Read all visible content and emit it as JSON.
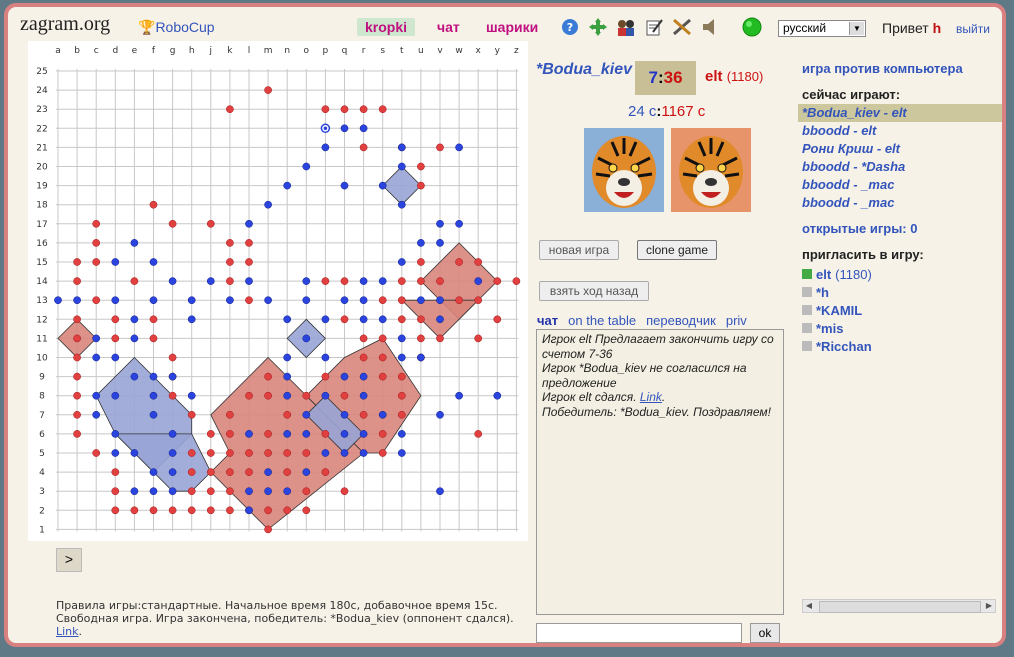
{
  "header": {
    "site": "zagram.org",
    "robocup": "RoboCup",
    "nav": [
      "kropki",
      "чат",
      "шарики"
    ],
    "icons": [
      "help-icon",
      "move-icon",
      "users-icon",
      "edit-icon",
      "tools-icon",
      "sound-icon",
      "status-icon"
    ],
    "language": "русский",
    "hello_prefix": "Привет ",
    "hello_user": "h",
    "logout": "выйти"
  },
  "board": {
    "columns": [
      "a",
      "b",
      "c",
      "d",
      "e",
      "f",
      "g",
      "h",
      "j",
      "k",
      "l",
      "m",
      "n",
      "o",
      "p",
      "q",
      "r",
      "s",
      "t",
      "u",
      "v",
      "w",
      "x",
      "y",
      "z"
    ],
    "rows": [
      "25",
      "24",
      "23",
      "22",
      "21",
      "20",
      "19",
      "18",
      "17",
      "16",
      "15",
      "14",
      "13",
      "12",
      "11",
      "10",
      "9",
      "8",
      "7",
      "6",
      "5",
      "4",
      "3",
      "2",
      "1"
    ],
    "colors": {
      "red": "#e04040",
      "blue": "#2a44dd",
      "red_area": "#d8857c",
      "blue_area": "#99a4d6"
    }
  },
  "game": {
    "player1": "*Bodua_kiev",
    "score1": "7",
    "score2": "36",
    "player2": "elt",
    "player2_rating": "(1180)",
    "time1": "24 с",
    "time2": "1167 с",
    "new_game": "новая игра",
    "clone_game": "clone game",
    "undo": "взять ход назад",
    "next": ">"
  },
  "chat": {
    "tabs": [
      "чат",
      "on the table",
      "переводчик",
      "priv"
    ],
    "lines": [
      "Игрок elt Предлагает закончить игру со счетом 7-36",
      "Игрок *Bodua_kiev не согласился на предложение",
      "Игрок elt сдался. ",
      "Победитель: *Bodua_kiev. Поздравляем!"
    ],
    "link": "Link",
    "ok": "ok"
  },
  "rules": {
    "text": "Правила игры:стандартные. Начальное время 180с, добавочное время 15с. Свободная игра. Игра закончена, победитель: *Bodua_kiev (оппонент сдался). ",
    "link": "Link"
  },
  "sidebar": {
    "vs_computer": "игра против компьютера",
    "now_playing": "сейчас играют:",
    "games": [
      "*Bodua_kiev - elt",
      "bboodd - elt",
      "Рони Криш - elt",
      "bboodd - *Dasha",
      "bboodd - _mac",
      "bboodd - _mac"
    ],
    "open_games": "открытые игры: 0",
    "invite": "пригласить в игру:",
    "users": [
      {
        "name": "elt",
        "rating": "(1180)",
        "online": true
      },
      {
        "name": "*h",
        "rating": "",
        "online": false
      },
      {
        "name": "*KAMIL",
        "rating": "",
        "online": false
      },
      {
        "name": "*mis",
        "rating": "",
        "online": false
      },
      {
        "name": "*Ricchan",
        "rating": "",
        "online": false
      }
    ]
  }
}
